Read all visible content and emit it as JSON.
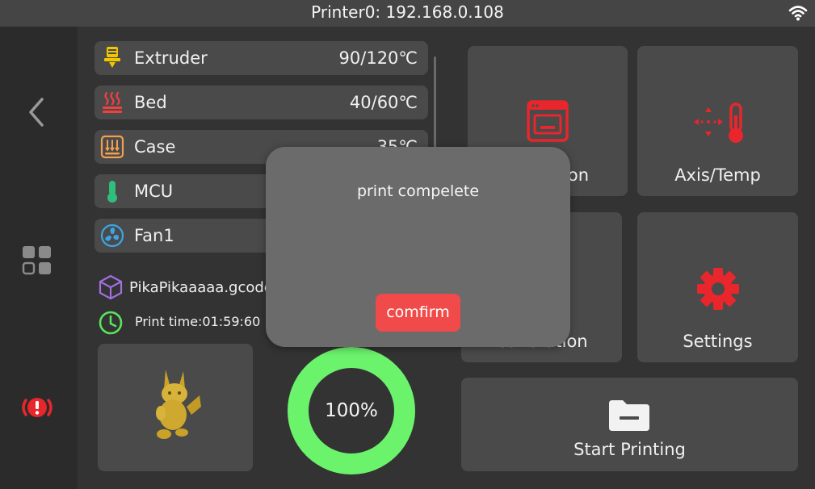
{
  "header": {
    "title": "Printer0: 192.168.0.108",
    "wifi_icon": "wifi-icon"
  },
  "sidebar": {
    "items": [
      {
        "icon": "back-chevron-icon"
      },
      {
        "icon": "grid-icon"
      },
      {
        "icon": "emergency-stop-icon",
        "color": "#e8262b"
      }
    ]
  },
  "sensors": [
    {
      "icon": "extruder-icon",
      "name": "Extruder",
      "value": "90/120℃",
      "color": "#f2c500"
    },
    {
      "icon": "heated-bed-icon",
      "name": "Bed",
      "value": "40/60℃",
      "color": "#f04040"
    },
    {
      "icon": "case-heater-icon",
      "name": "Case",
      "value": "35℃",
      "color": "#f0a050"
    },
    {
      "icon": "thermometer-icon",
      "name": "MCU",
      "value": "",
      "color": "#2fbf7c"
    },
    {
      "icon": "fan-icon",
      "name": "Fan1",
      "value": "",
      "color": "#3aa6e6"
    }
  ],
  "job": {
    "filename": "PikaPikaaaaa.gcode",
    "print_time": "Print time:01:59:60",
    "progress_label": "100%",
    "progress_fraction": 1.0,
    "progress_color": "#6cf36c"
  },
  "tiles": [
    {
      "id": "detection",
      "label": "Detection",
      "icon": "printer-icon"
    },
    {
      "id": "axis",
      "label": "Axis/Temp",
      "icon": "axis-temp-icon"
    },
    {
      "id": "calibration",
      "label": "Calibration",
      "icon": "calibration-icon"
    },
    {
      "id": "settings",
      "label": "Settings",
      "icon": "gear-icon"
    },
    {
      "id": "start",
      "label": "Start Printing",
      "icon": "folder-icon"
    }
  ],
  "dialog": {
    "message": "print compelete",
    "confirm_label": "comfirm"
  },
  "colors": {
    "accent": "#f14a4a",
    "icon_red": "#e8262b",
    "background": "#333333",
    "panel": "#4a4a4a"
  }
}
